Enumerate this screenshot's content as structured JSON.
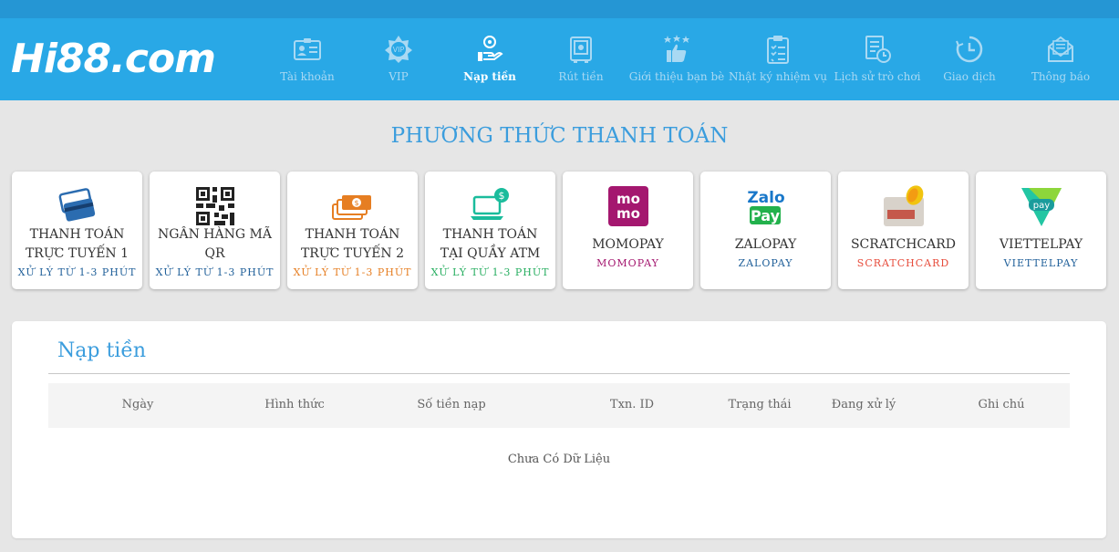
{
  "logo": {
    "text": "Hi88.com"
  },
  "nav": {
    "items": [
      {
        "label": "Tài khoản",
        "icon": "id-card-icon"
      },
      {
        "label": "VIP",
        "icon": "vip-badge-icon"
      },
      {
        "label": "Nạp tiền",
        "icon": "deposit-hand-coin-icon",
        "active": true
      },
      {
        "label": "Rút tiền",
        "icon": "withdraw-safe-icon"
      },
      {
        "label": "Giới thiệu bạn bè",
        "icon": "thumbs-up-stars-icon"
      },
      {
        "label": "Nhật ký nhiệm vụ",
        "icon": "clipboard-checklist-icon"
      },
      {
        "label": "Lịch sử trò chơi",
        "icon": "history-document-clock-icon"
      },
      {
        "label": "Giao dịch",
        "icon": "transaction-clock-icon"
      },
      {
        "label": "Thông báo",
        "icon": "envelope-icon"
      }
    ]
  },
  "payment": {
    "title": "PHƯƠNG THỨC THANH TOÁN",
    "methods": [
      {
        "line1": "THANH TOÁN",
        "line2": "TRỰC TUYẾN 1",
        "sub": "XỬ LÝ TỪ 1-3 PHÚT",
        "sub_color": "#1f5f99",
        "icon": "credit-cards-icon"
      },
      {
        "line1": "NGÂN HÀNG MÃ",
        "line2": "QR",
        "sub": "XỬ LÝ TỪ 1-3 PHÚT",
        "sub_color": "#1f5f99",
        "icon": "qr-code-icon"
      },
      {
        "line1": "THANH TOÁN",
        "line2": "TRỰC TUYẾN 2",
        "sub": "XỬ LÝ TỪ 1-3 PHÚT",
        "sub_color": "#e67e22",
        "icon": "cash-stack-icon"
      },
      {
        "line1": "THANH TOÁN",
        "line2": "TẠI QUẦY ATM",
        "sub": "XỬ LÝ TỪ 1-3 PHÚT",
        "sub_color": "#27ae60",
        "icon": "atm-laptop-icon"
      },
      {
        "line1": "MOMOPAY",
        "line2": "",
        "sub": "MOMOPAY",
        "sub_color": "#a4176f",
        "icon": "momo-logo-icon"
      },
      {
        "line1": "ZALOPAY",
        "line2": "",
        "sub": "ZALOPAY",
        "sub_color": "#1f5f99",
        "icon": "zalopay-logo-icon"
      },
      {
        "line1": "SCRATCHCARD",
        "line2": "",
        "sub": "SCRATCHCARD",
        "sub_color": "#e74c3c",
        "icon": "scratch-card-icon"
      },
      {
        "line1": "VIETTELPAY",
        "line2": "",
        "sub": "VIETTELPAY",
        "sub_color": "#1f5f99",
        "icon": "viettelpay-logo-icon"
      }
    ]
  },
  "history": {
    "title": "Nạp tiền",
    "columns": [
      "Ngày",
      "Hình thức",
      "Số tiền nạp",
      "Txn. ID",
      "Trạng thái",
      "Đang xử lý",
      "Ghi chú"
    ],
    "empty_text": "Chưa Có Dữ Liệu"
  },
  "colors": {
    "header": "#29a8e6",
    "accent": "#3b9ddd",
    "nav_inactive": "#a9d9f3"
  }
}
